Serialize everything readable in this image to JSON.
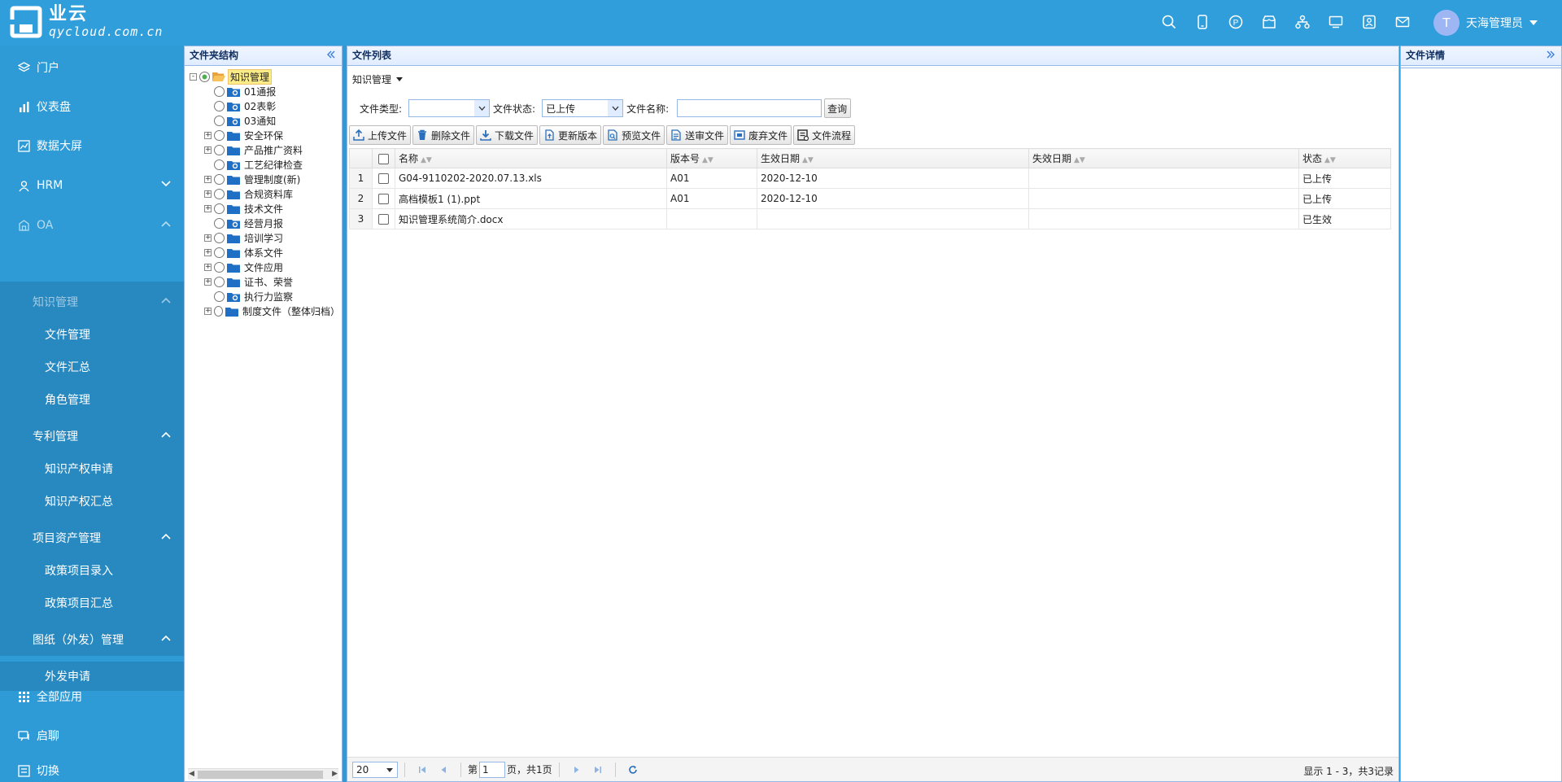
{
  "app": {
    "logo_name": "业云",
    "logo_domain": "qycloud.com.cn",
    "username": "天海管理员",
    "avatar_letter": "T",
    "top_icons": [
      "search-icon",
      "mobile-icon",
      "points-icon",
      "store-icon",
      "org-icon",
      "monitor-icon",
      "contact-icon",
      "mail-icon"
    ]
  },
  "sidebar": {
    "portal": "门户",
    "dashboard": "仪表盘",
    "bigscreen": "数据大屏",
    "hrm": "HRM",
    "oa": "OA",
    "km": "知识管理",
    "km_items": [
      "文件管理",
      "文件汇总",
      "角色管理"
    ],
    "patent": "专利管理",
    "patent_items": [
      "知识产权申请",
      "知识产权汇总"
    ],
    "project": "项目资产管理",
    "project_items": [
      "政策项目录入",
      "政策项目汇总"
    ],
    "drawing": "图纸（外发）管理",
    "drawing_items": [
      "外发申请"
    ],
    "all_apps": "全部应用",
    "chat": "启聊",
    "switch": "切换"
  },
  "tree_panel": {
    "title": "文件夹结构",
    "nodes": [
      {
        "label": "知识管理",
        "level": 0,
        "expander": "-",
        "selected": true
      },
      {
        "label": "01通报",
        "level": 1,
        "expander": "",
        "selected": false
      },
      {
        "label": "02表彰",
        "level": 1,
        "expander": "",
        "selected": false
      },
      {
        "label": "03通知",
        "level": 1,
        "expander": "",
        "selected": false
      },
      {
        "label": "安全环保",
        "level": 1,
        "expander": "+",
        "selected": false
      },
      {
        "label": "产品推广资料",
        "level": 1,
        "expander": "+",
        "selected": false
      },
      {
        "label": "工艺纪律检查",
        "level": 1,
        "expander": "",
        "selected": false
      },
      {
        "label": "管理制度(新)",
        "level": 1,
        "expander": "+",
        "selected": false
      },
      {
        "label": "合规资料库",
        "level": 1,
        "expander": "+",
        "selected": false
      },
      {
        "label": "技术文件",
        "level": 1,
        "expander": "+",
        "selected": false
      },
      {
        "label": "经营月报",
        "level": 1,
        "expander": "",
        "selected": false
      },
      {
        "label": "培训学习",
        "level": 1,
        "expander": "+",
        "selected": false
      },
      {
        "label": "体系文件",
        "level": 1,
        "expander": "+",
        "selected": false
      },
      {
        "label": "文件应用",
        "level": 1,
        "expander": "+",
        "selected": false
      },
      {
        "label": "证书、荣誉",
        "level": 1,
        "expander": "+",
        "selected": false
      },
      {
        "label": "执行力监察",
        "level": 1,
        "expander": "",
        "selected": false
      },
      {
        "label": "制度文件（整体归档）",
        "level": 1,
        "expander": "+",
        "selected": false
      }
    ]
  },
  "file_list": {
    "title": "文件列表",
    "breadcrumb": "知识管理",
    "filter": {
      "type_label": "文件类型:",
      "type_value": "",
      "status_label": "文件状态:",
      "status_value": "已上传",
      "name_label": "文件名称:",
      "name_value": "",
      "query_button": "查询"
    },
    "toolbar": [
      "上传文件",
      "删除文件",
      "下载文件",
      "更新版本",
      "预览文件",
      "送审文件",
      "废弃文件",
      "文件流程"
    ],
    "columns": [
      "名称",
      "版本号",
      "生效日期",
      "失效日期",
      "状态"
    ],
    "rows": [
      {
        "num": "1",
        "name": "G04-9110202-2020.07.13.xls",
        "version": "A01",
        "effective": "2020-12-10",
        "expire": "",
        "status": "已上传"
      },
      {
        "num": "2",
        "name": "高档模板1 (1).ppt",
        "version": "A01",
        "effective": "2020-12-10",
        "expire": "",
        "status": "已上传"
      },
      {
        "num": "3",
        "name": "知识管理系统简介.docx",
        "version": "",
        "effective": "",
        "expire": "",
        "status": "已生效"
      }
    ],
    "pager": {
      "page_size": "20",
      "page_prefix": "第",
      "page_value": "1",
      "page_suffix": "页，共1页",
      "info": "显示 1 - 3，共3记录"
    }
  },
  "detail_panel": {
    "title": "文件详情"
  },
  "colors": {
    "brand": "#2f9edb",
    "submenu": "#2889c0",
    "panel_border": "#95b8e7"
  }
}
